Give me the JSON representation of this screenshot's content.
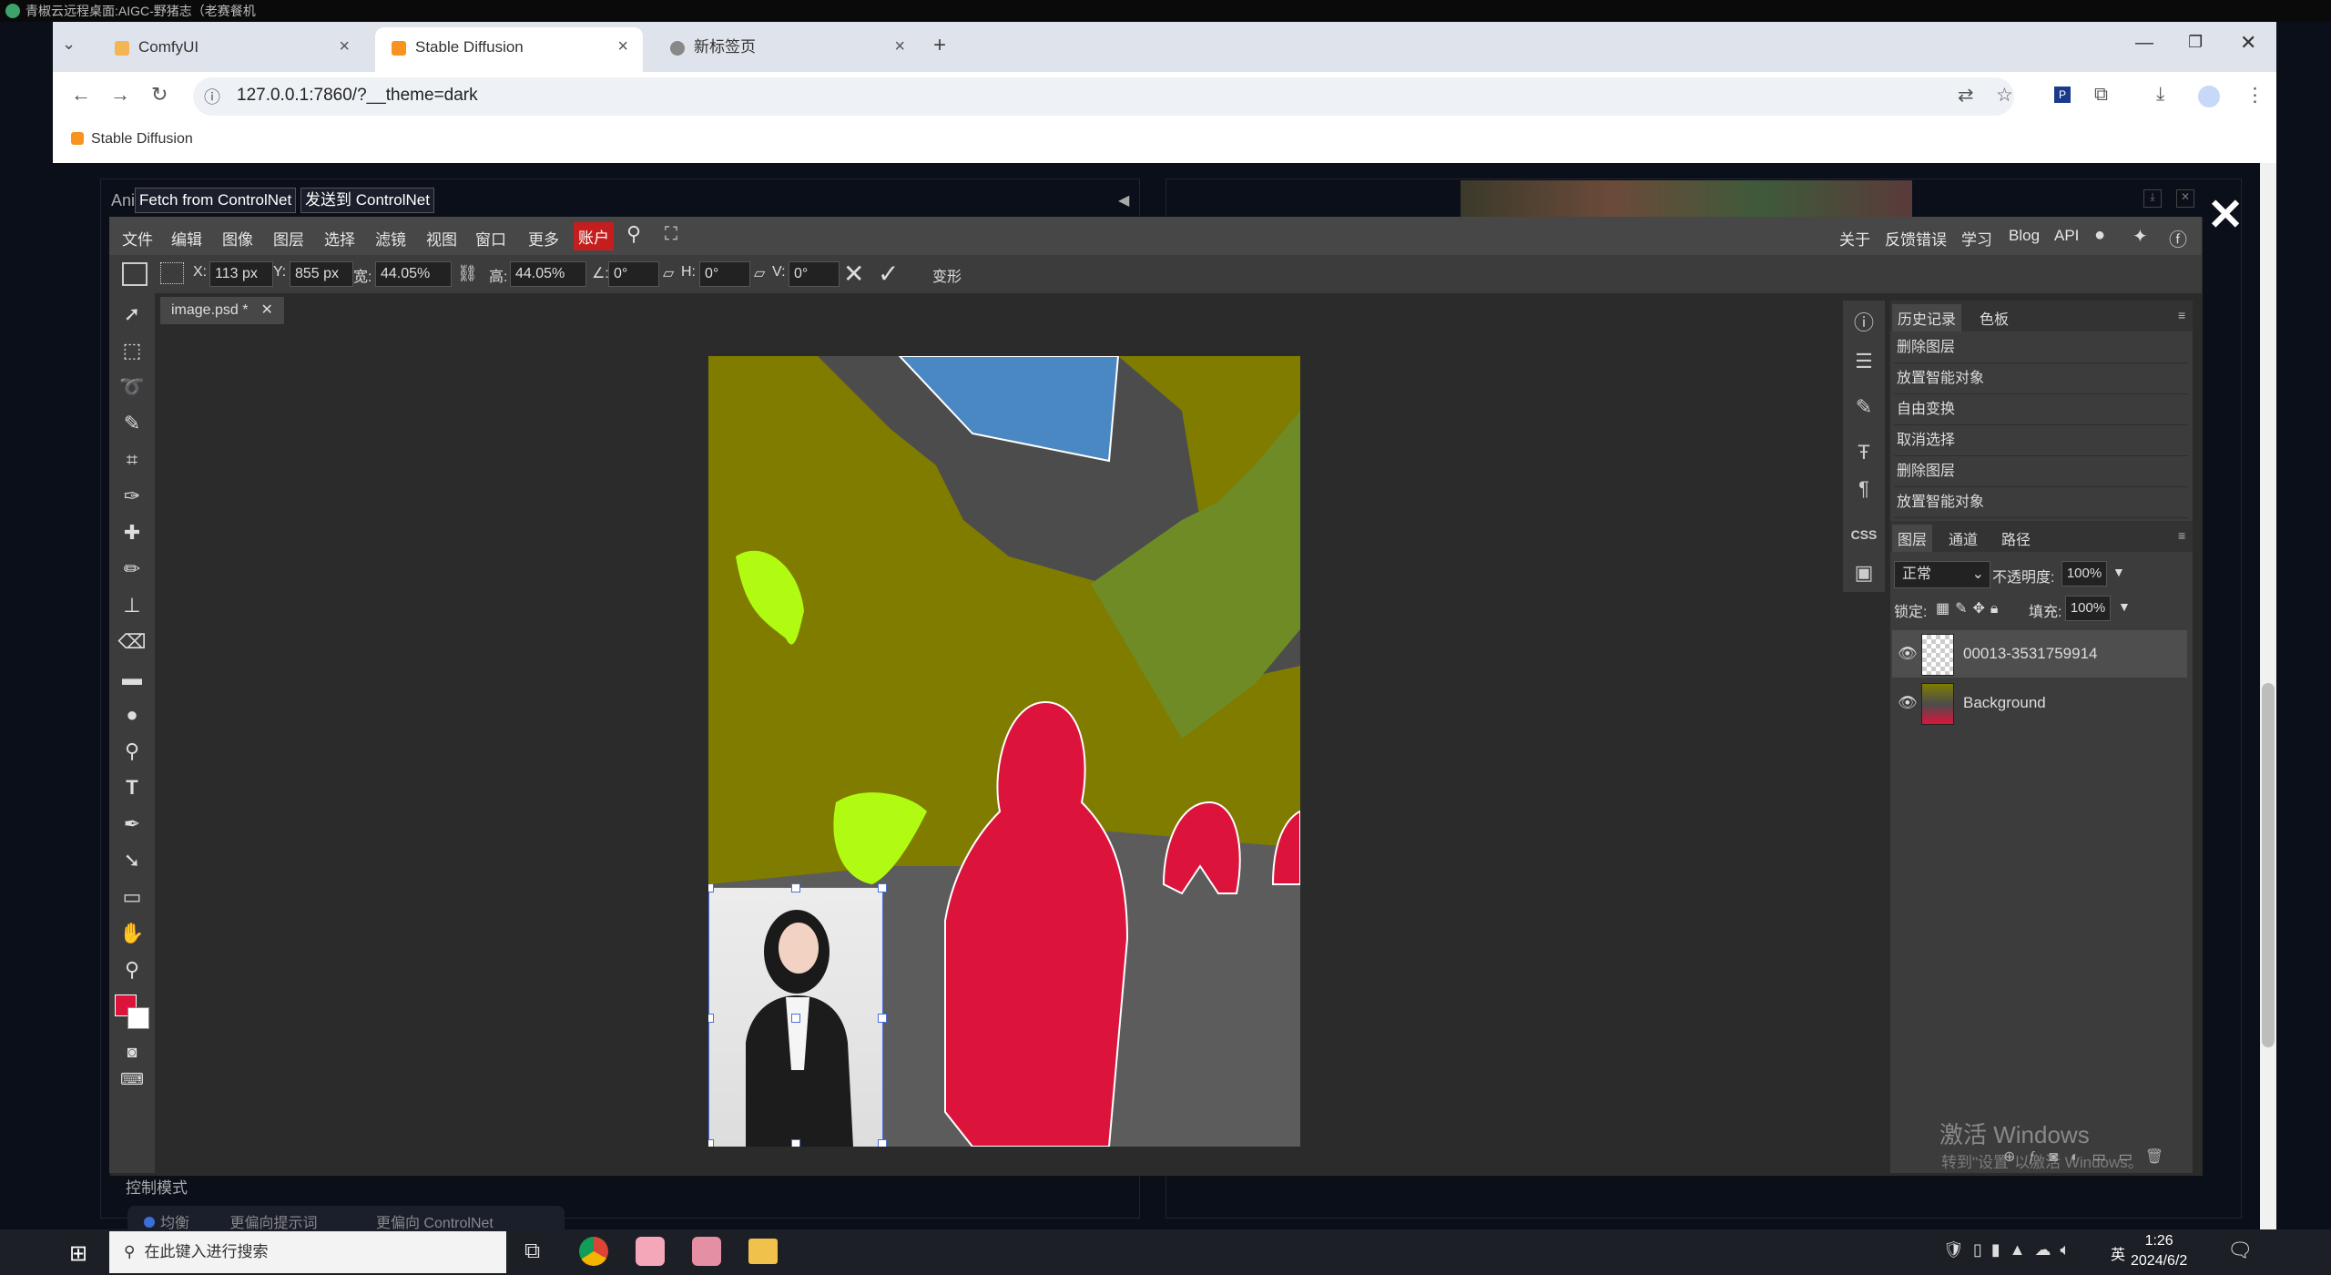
{
  "remote": {
    "title": "青椒云远程桌面:AIGC-野猪志（老赛餐机"
  },
  "browser": {
    "tabs": [
      {
        "label": "ComfyUI",
        "color": "#f5b553"
      },
      {
        "label": "Stable Diffusion",
        "color": "#f7931e",
        "active": true
      },
      {
        "label": "新标签页",
        "color": "#888"
      }
    ],
    "url": "127.0.0.1:7860/?__theme=dark",
    "bookmark": "Stable Diffusion"
  },
  "webui": {
    "fetch_btn": "Fetch from ControlNet",
    "send_btn": "发送到 ControlNet",
    "section_label": "Animation",
    "control_mode": "控制模式",
    "mode_options": [
      "均衡",
      "更偏向提示词",
      "更偏向 ControlNet"
    ]
  },
  "photopea": {
    "menu": [
      "文件",
      "编辑",
      "图像",
      "图层",
      "选择",
      "滤镜",
      "视图",
      "窗口",
      "更多",
      "账户"
    ],
    "menu_right": [
      "关于",
      "反馈错误",
      "学习",
      "Blog",
      "API"
    ],
    "options": {
      "x_label": "X:",
      "x": "113 px",
      "y_label": "Y:",
      "y": "855 px",
      "w_label": "宽:",
      "w": "44.05%",
      "h_label": "高:",
      "h": "44.05%",
      "angle_label": "∠:",
      "angle": "0°",
      "hskew_label": "H:",
      "hskew": "0°",
      "vskew_label": "V:",
      "vskew": "0°",
      "transform": "变形"
    },
    "doc_tab": "image.psd *",
    "history_tabs": [
      "历史记录",
      "色板"
    ],
    "history": [
      "删除图层",
      "放置智能对象",
      "自由变换",
      "取消选择",
      "删除图层",
      "放置智能对象"
    ],
    "layer_tabs": [
      "图层",
      "通道",
      "路径"
    ],
    "blend": "正常",
    "opacity_label": "不透明度:",
    "opacity": "100%",
    "lock_label": "锁定:",
    "fill_label": "填充:",
    "fill": "100%",
    "layers": [
      "00013-3531759914",
      "Background"
    ],
    "watermark1": "激活 Windows",
    "watermark2": "转到\"设置\"以激活 Windows。"
  },
  "taskbar": {
    "search": "在此键入进行搜索",
    "time": "1:26",
    "date": "2024/6/2",
    "ime": "英"
  }
}
